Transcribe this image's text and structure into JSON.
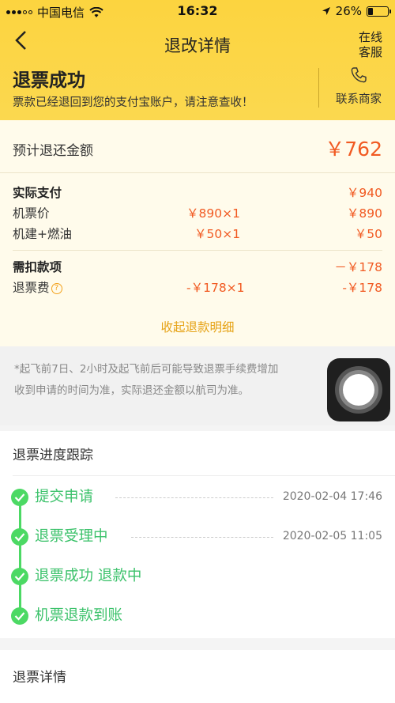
{
  "status_bar": {
    "carrier": "中国电信",
    "time": "16:32",
    "battery": "26%"
  },
  "nav": {
    "title": "退改详情",
    "online_cs": "在线客服"
  },
  "status": {
    "title": "退票成功",
    "desc": "票款已经退回到您的支付宝账户，请注意查收！",
    "contact_label": "联系商家"
  },
  "refund": {
    "estimate_label": "预计退还金额",
    "estimate_amount": "￥762",
    "paid": {
      "label": "实际支付",
      "total": "￥940"
    },
    "ticket": {
      "label": "机票价",
      "unit": "￥890×1",
      "amount": "￥890"
    },
    "tax": {
      "label": "机建+燃油",
      "unit": "￥50×1",
      "amount": "￥50"
    },
    "deduct": {
      "label": "需扣款项",
      "total": "－￥178"
    },
    "fee": {
      "label": "退票费",
      "help": "?",
      "unit": "-￥178×1",
      "amount": "-￥178"
    },
    "collapse": "收起退款明细"
  },
  "notice": {
    "line1": "*起飞前7日、2小时及起飞前后可能导致退票手续费增加",
    "line2": "收到申请的时间为准，实际退还金额以航司为准。"
  },
  "progress": {
    "title": "退票进度跟踪",
    "steps": [
      {
        "label": "提交申请",
        "time": "2020-02-04 17:46"
      },
      {
        "label": "退票受理中",
        "time": "2020-02-05 11:05"
      },
      {
        "label": "退票成功 退款中",
        "time": ""
      },
      {
        "label": "机票退款到账",
        "time": ""
      }
    ]
  },
  "detail": {
    "title": "退票详情"
  },
  "colors": {
    "header": "#fcd43f",
    "accent": "#f15a22",
    "success": "#4cd964",
    "link": "#e6a214"
  }
}
